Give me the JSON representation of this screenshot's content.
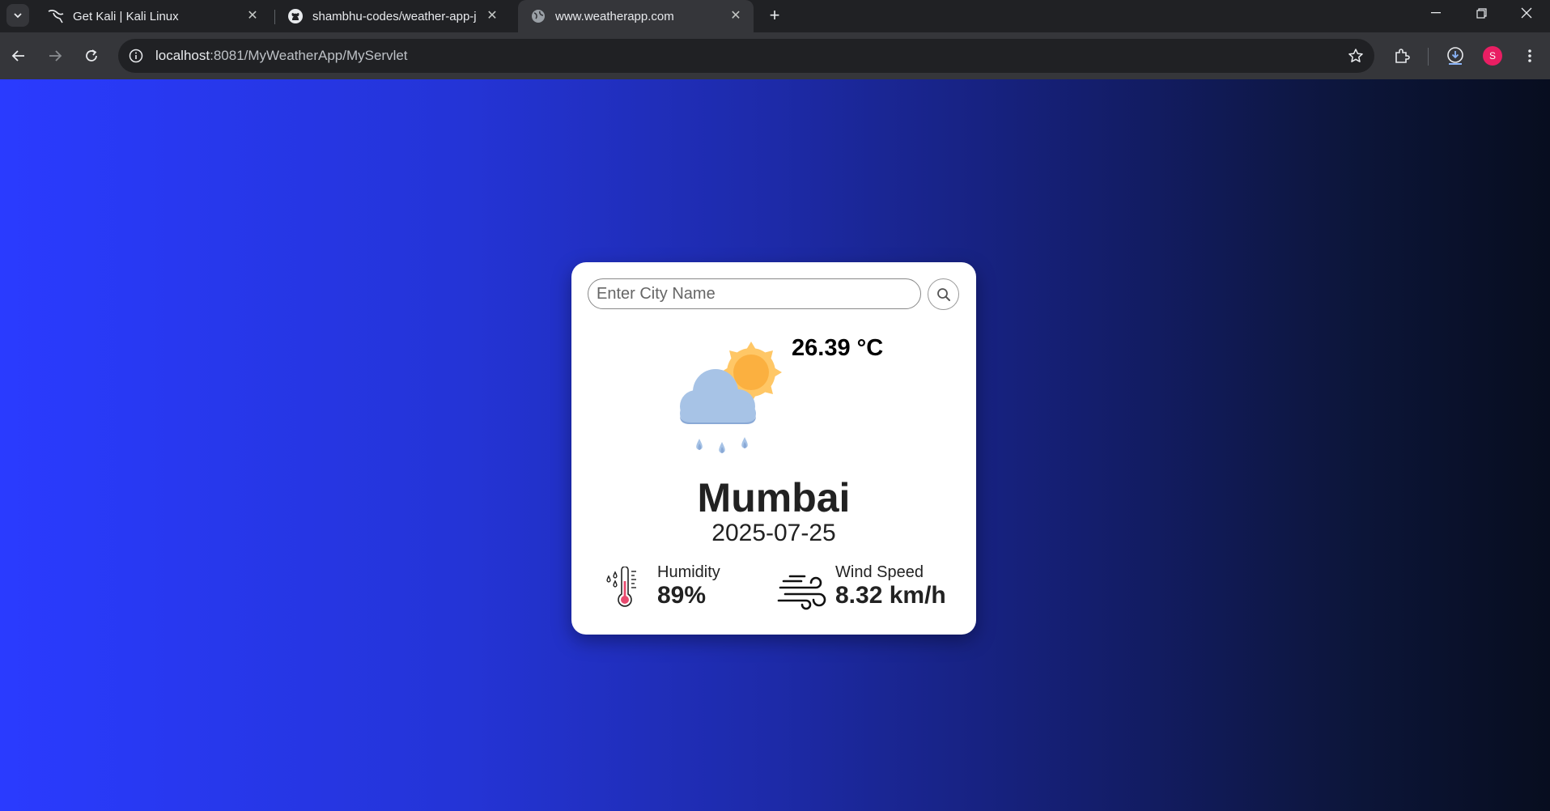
{
  "browser": {
    "tabs": [
      {
        "title": "Get Kali | Kali Linux",
        "favicon": "kali-dragon-icon",
        "active": false
      },
      {
        "title": "shambhu-codes/weather-app-j",
        "favicon": "github-icon",
        "active": false
      },
      {
        "title": "www.weatherapp.com",
        "favicon": "globe-icon",
        "active": true
      }
    ],
    "url_host": "localhost",
    "url_rest": ":8081/MyWeatherApp/MyServlet",
    "profile_initial": "S"
  },
  "weather": {
    "search_placeholder": "Enter City Name",
    "temperature": "26.39 °C",
    "condition_icon": "cloud-sun-rain-icon",
    "city": "Mumbai",
    "date": "2025-07-25",
    "humidity_label": "Humidity",
    "humidity_value": "89%",
    "wind_label": "Wind Speed",
    "wind_value": "8.32 km/h"
  }
}
